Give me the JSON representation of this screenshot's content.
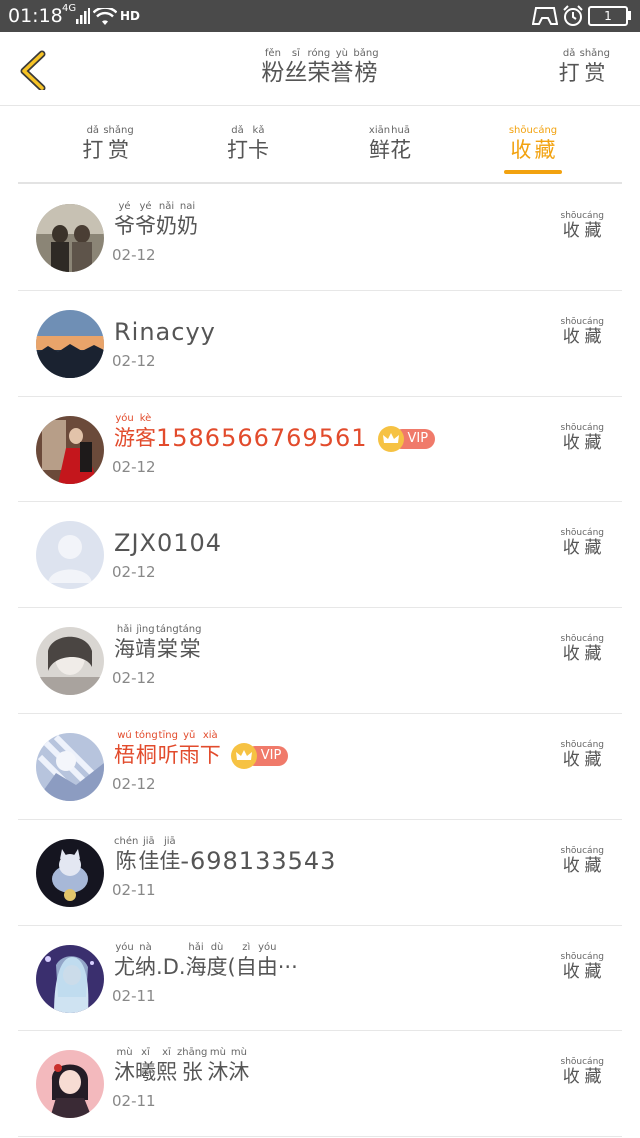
{
  "status_bar": {
    "time": "01:18",
    "network": "4G",
    "hd_label": "HD",
    "battery": "1"
  },
  "header": {
    "title": [
      {
        "py": "fěn",
        "ch": "粉"
      },
      {
        "py": "sī",
        "ch": "丝"
      },
      {
        "py": "róng",
        "ch": "荣"
      },
      {
        "py": "yù",
        "ch": "誉"
      },
      {
        "py": "bǎng",
        "ch": "榜"
      }
    ],
    "reward_button": [
      {
        "py": "dǎ",
        "ch": "打"
      },
      {
        "py": "shǎng",
        "ch": "赏"
      }
    ]
  },
  "tabs": [
    {
      "chars": [
        {
          "py": "dǎ",
          "ch": "打"
        },
        {
          "py": "shǎng",
          "ch": "赏"
        }
      ],
      "active": false
    },
    {
      "chars": [
        {
          "py": "dǎ",
          "ch": "打"
        },
        {
          "py": "kǎ",
          "ch": "卡"
        }
      ],
      "active": false
    },
    {
      "chars": [
        {
          "py": "xiān",
          "ch": "鲜"
        },
        {
          "py": "huā",
          "ch": "花"
        }
      ],
      "active": false
    },
    {
      "chars": [
        {
          "py": "shōu",
          "ch": "收"
        },
        {
          "py": "cáng",
          "ch": "藏"
        }
      ],
      "active": true
    }
  ],
  "action_label": [
    {
      "py": "shōu",
      "ch": "收"
    },
    {
      "py": "cáng",
      "ch": "藏"
    }
  ],
  "colors": {
    "accent": "#f2a20f",
    "vip_name": "#e24b2c",
    "vip_badge": "#f07a6a"
  },
  "vip_label": "VIP",
  "entries": [
    {
      "name_parts": [
        {
          "py": "yé",
          "ch": "爷"
        },
        {
          "py": "yé",
          "ch": "爷"
        },
        {
          "py": "nǎi",
          "ch": "奶"
        },
        {
          "py": "nai",
          "ch": "奶"
        }
      ],
      "latin": "",
      "date": "02-12",
      "vip": false,
      "avatar": "photo-couple"
    },
    {
      "name_parts": [],
      "latin": "Rinacyy",
      "date": "02-12",
      "vip": false,
      "avatar": "sunset"
    },
    {
      "name_parts": [
        {
          "py": "yóu",
          "ch": "游"
        },
        {
          "py": "kè",
          "ch": "客"
        }
      ],
      "latin": "1586566769561",
      "date": "02-12",
      "vip": true,
      "avatar": "wedding"
    },
    {
      "name_parts": [],
      "latin": "ZJX0104",
      "date": "02-12",
      "vip": false,
      "avatar": "default-user"
    },
    {
      "name_parts": [
        {
          "py": "hǎi",
          "ch": "海"
        },
        {
          "py": "jìng",
          "ch": "靖"
        },
        {
          "py": "táng",
          "ch": "棠"
        },
        {
          "py": "táng",
          "ch": "棠"
        }
      ],
      "latin": "",
      "date": "02-12",
      "vip": false,
      "avatar": "portrait-gray"
    },
    {
      "name_parts": [
        {
          "py": "wú",
          "ch": "梧"
        },
        {
          "py": "tóng",
          "ch": "桐"
        },
        {
          "py": "tīng",
          "ch": "听"
        },
        {
          "py": "yǔ",
          "ch": "雨"
        },
        {
          "py": "xià",
          "ch": "下"
        }
      ],
      "latin": "",
      "date": "02-12",
      "vip": true,
      "avatar": "anime-white"
    },
    {
      "name_parts": [
        {
          "py": "chén",
          "ch": "陈"
        },
        {
          "py": "jiā",
          "ch": "佳"
        },
        {
          "py": "jiā",
          "ch": "佳"
        }
      ],
      "latin": "-698133543",
      "date": "02-11",
      "vip": false,
      "avatar": "cat-night"
    },
    {
      "name_parts": [
        {
          "py": "yóu",
          "ch": "尤"
        },
        {
          "py": "nà",
          "ch": "纳"
        },
        {
          "py": "",
          "ch": "."
        },
        {
          "py": "",
          "ch": "D"
        },
        {
          "py": "",
          "ch": "."
        },
        {
          "py": "hǎi",
          "ch": "海"
        },
        {
          "py": "dù",
          "ch": "度"
        },
        {
          "py": "",
          "ch": "("
        },
        {
          "py": "zì",
          "ch": "自"
        },
        {
          "py": "yóu",
          "ch": "由"
        },
        {
          "py": "",
          "ch": "···"
        }
      ],
      "latin": "",
      "date": "02-11",
      "vip": false,
      "avatar": "anime-purple"
    },
    {
      "name_parts": [
        {
          "py": "mù",
          "ch": "沐"
        },
        {
          "py": "xī",
          "ch": "曦"
        },
        {
          "py": "xī",
          "ch": "熙"
        },
        {
          "py": "zhāng",
          "ch": "张"
        },
        {
          "py": "mù",
          "ch": "沐"
        },
        {
          "py": "mù",
          "ch": "沐"
        }
      ],
      "latin": "",
      "date": "02-11",
      "vip": false,
      "avatar": "anime-girl"
    }
  ]
}
